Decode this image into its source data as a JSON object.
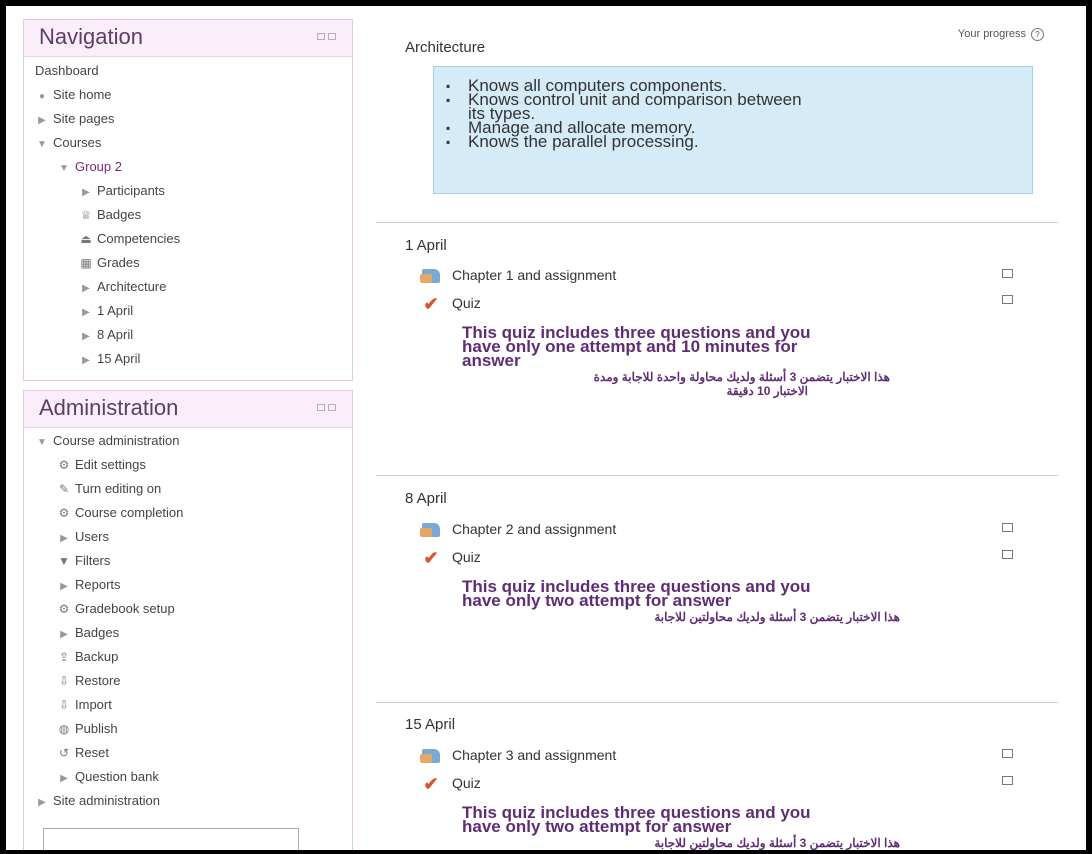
{
  "navigation": {
    "title": "Navigation",
    "items": [
      {
        "label": "Dashboard"
      },
      {
        "label": "Site home"
      },
      {
        "label": "Site pages"
      },
      {
        "label": "Courses"
      },
      {
        "label": "Group 2"
      },
      {
        "label": "Participants"
      },
      {
        "label": "Badges"
      },
      {
        "label": "Competencies"
      },
      {
        "label": "Grades"
      },
      {
        "label": "Architecture"
      },
      {
        "label": "1 April"
      },
      {
        "label": "8 April"
      },
      {
        "label": "15 April"
      }
    ]
  },
  "administration": {
    "title": "Administration",
    "items": [
      {
        "label": "Course administration"
      },
      {
        "label": "Edit settings"
      },
      {
        "label": "Turn editing on"
      },
      {
        "label": "Course completion"
      },
      {
        "label": "Users"
      },
      {
        "label": "Filters"
      },
      {
        "label": "Reports"
      },
      {
        "label": "Gradebook setup"
      },
      {
        "label": "Badges"
      },
      {
        "label": "Backup"
      },
      {
        "label": "Restore"
      },
      {
        "label": "Import"
      },
      {
        "label": "Publish"
      },
      {
        "label": "Reset"
      },
      {
        "label": "Question bank"
      },
      {
        "label": "Site administration"
      }
    ]
  },
  "main": {
    "progress_label": "Your progress",
    "progress_help": "?",
    "architecture": {
      "title": "Architecture",
      "summary": [
        "Knows all computers components.",
        "Knows control unit and comparison between",
        "its types.",
        "Manage and allocate memory.",
        "Knows the parallel processing."
      ]
    },
    "sections": [
      {
        "title": "1 April",
        "assignment": "Chapter 1 and assignment",
        "quiz": "Quiz",
        "quiz_desc": [
          "This quiz includes three questions and you",
          "have only one attempt and 10 minutes for",
          "answer"
        ],
        "quiz_ar": [
          "هذا الاختبار يتضمن 3 أسئلة ولديك محاولة واحدة للاجابة ومدة",
          "الاختبار 10 دقيقة"
        ]
      },
      {
        "title": "8 April",
        "assignment": "Chapter 2 and assignment",
        "quiz": "Quiz",
        "quiz_desc": [
          "This quiz includes three questions and you",
          "have only two attempt for answer"
        ],
        "quiz_ar": [
          "هذا الاختبار يتضمن 3 أسئلة ولديك محاولتين للاجابة"
        ]
      },
      {
        "title": "15 April",
        "assignment": "Chapter 3 and assignment",
        "quiz": "Quiz",
        "quiz_desc": [
          "This quiz includes three questions and you",
          "have only two attempt for answer"
        ],
        "quiz_ar": [
          "هذا الاختبار يتضمن 3 أسئلة ولديك محاولتين للاجابة"
        ]
      }
    ]
  }
}
